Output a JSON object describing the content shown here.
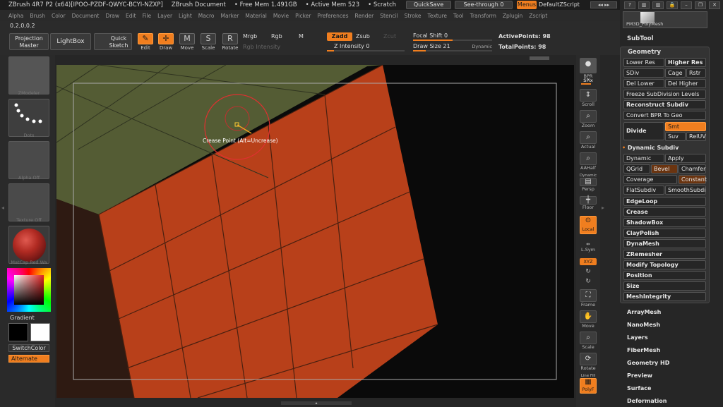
{
  "titlebar": {
    "app": "ZBrush 4R7 P2 (x64)[IPOO-PZDF-QWYC-BCYI-NZXP]",
    "doc": "ZBrush Document",
    "free_mem": "• Free Mem 1.491GB",
    "active_mem": "• Active Mem 523",
    "scratch": "• Scratch",
    "quicksave": "QuickSave",
    "see_through": "See-through",
    "see_through_value": "0",
    "menus": "Menus",
    "default_script": "DefaultZScript"
  },
  "menubar": [
    "Alpha",
    "Brush",
    "Color",
    "Document",
    "Draw",
    "Edit",
    "File",
    "Layer",
    "Light",
    "Macro",
    "Marker",
    "Material",
    "Movie",
    "Picker",
    "Preferences",
    "Render",
    "Stencil",
    "Stroke",
    "Texture",
    "Tool",
    "Transform",
    "Zplugin",
    "Zscript"
  ],
  "toolbar": {
    "coords": "0.2,0,0.2",
    "projection_master": "Projection Master",
    "lightbox": "LightBox",
    "quick_sketch": "Quick Sketch",
    "edit": "Edit",
    "draw": "Draw",
    "move": "Move",
    "scale": "Scale",
    "rotate": "Rotate",
    "mrgb": "Mrgb",
    "rgb": "Rgb",
    "m": "M",
    "rgb_intensity": "Rgb Intensity",
    "zadd": "Zadd",
    "zsub": "Zsub",
    "zcut": "Zcut",
    "z_intensity_label": "Z Intensity",
    "z_intensity": "0",
    "focal_shift_label": "Focal Shift",
    "focal_shift": "0",
    "draw_size_label": "Draw Size",
    "draw_size": "21",
    "dynamic": "Dynamic",
    "active_points_label": "ActivePoints:",
    "active_points": "98",
    "total_points_label": "TotalPoints:",
    "total_points": "98"
  },
  "left": {
    "zmodeler": "ZModeler",
    "dots": "Dots",
    "alpha": "Alpha Off",
    "texture": "Texture Off",
    "matcap": "MatCap Red Wa",
    "gradient": "Gradient",
    "switchcolor": "SwitchColor",
    "alternate": "Alternate"
  },
  "viewport": {
    "tooltip": "Crease Point (Alt=Uncrease)"
  },
  "shelf": {
    "bpr": "BPR",
    "spix": "SPix",
    "scroll": "Scroll",
    "zoom": "Zoom",
    "actual": "Actual",
    "aahalf": "AAHalf",
    "dynamic": "Dynamic",
    "persp": "Persp",
    "floor": "Floor",
    "local": "Local",
    "lsym": "L.Sym",
    "xyz": "XYZ",
    "frame": "Frame",
    "move": "Move",
    "scale": "Scale",
    "rotate": "Rotate",
    "polyf": "PolyF",
    "linefill": "Line Fill"
  },
  "right": {
    "tool_thumb": "PM3D_PolyMesh",
    "subtool": "SubTool",
    "geometry": "Geometry",
    "lower_res": "Lower Res",
    "higher_res": "Higher Res",
    "sdiv": "SDiv",
    "cage": "Cage",
    "rstr": "Rstr",
    "del_lower": "Del Lower",
    "del_higher": "Del Higher",
    "freeze": "Freeze SubDivision Levels",
    "reconstruct": "Reconstruct Subdiv",
    "convert_bpr": "Convert BPR To Geo",
    "divide": "Divide",
    "smt": "Smt",
    "suv": "Suv",
    "reluv": "RelUV",
    "dynamic_subdiv": "Dynamic Subdiv",
    "dynamic": "Dynamic",
    "apply": "Apply",
    "qgrid": "QGrid",
    "bevel": "Bevel",
    "chamfer": "Chamfer",
    "coverage": "Coverage",
    "constant": "Constant",
    "flatsubdiv": "FlatSubdiv",
    "smoothsubdiv": "SmoothSubdi",
    "edgeloop": "EdgeLoop",
    "crease": "Crease",
    "shadowbox": "ShadowBox",
    "claypolish": "ClayPolish",
    "dynamesh": "DynaMesh",
    "zremesher": "ZRemesher",
    "modify_topology": "Modify Topology",
    "position": "Position",
    "size": "Size",
    "meshintegrity": "MeshIntegrity",
    "arraymesh": "ArrayMesh",
    "nanomesh": "NanoMesh",
    "layers": "Layers",
    "fibermesh": "FiberMesh",
    "geometry_hd": "Geometry HD",
    "preview": "Preview",
    "surface": "Surface",
    "deformation": "Deformation"
  },
  "colors": {
    "accent": "#f07e1f",
    "mesh_orange": "#b8401a",
    "mesh_green": "#545c34"
  }
}
